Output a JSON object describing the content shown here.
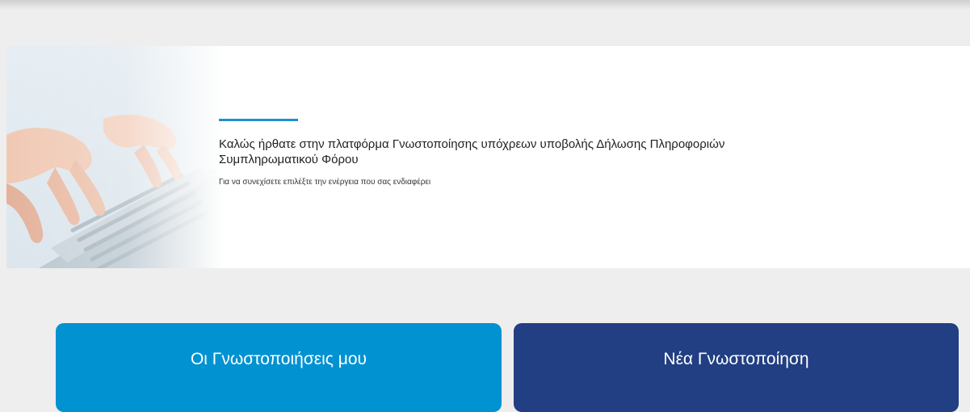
{
  "banner": {
    "title": "Καλώς ήρθατε στην πλατφόρμα Γνωστοποίησης υπόχρεων υποβολής Δήλωσης Πληροφοριών Συμπληρωματικού Φόρου",
    "subtitle": "Για να συνεχίσετε επιλέξτε την ενέργεια που σας ενδιαφέρει",
    "accent_color": "#1f8fd1"
  },
  "actions": {
    "my_notifications_label": "Οι Γνωστοποιήσεις μου",
    "my_notifications_color": "#0192d2",
    "new_notification_label": "Νέα Γνωστοποίηση",
    "new_notification_color": "#213f82"
  }
}
